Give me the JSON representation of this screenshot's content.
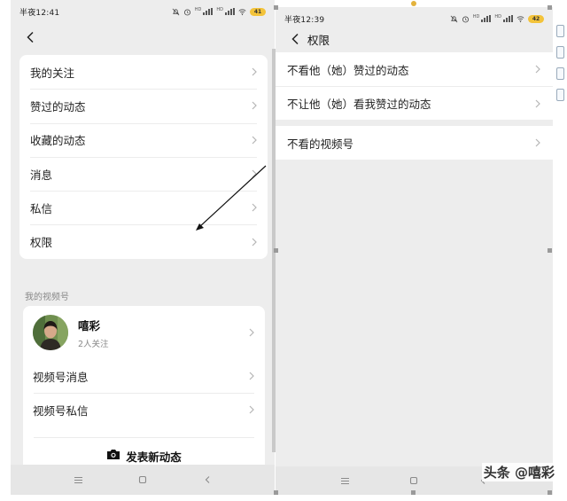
{
  "left": {
    "status": {
      "time": "半夜12:41",
      "battery": "41"
    },
    "menu": [
      {
        "label": "我的关注"
      },
      {
        "label": "赞过的动态"
      },
      {
        "label": "收藏的动态"
      },
      {
        "label": "消息"
      },
      {
        "label": "私信"
      },
      {
        "label": "权限"
      }
    ],
    "section_label": "我的视频号",
    "profile": {
      "name": "嘻彩",
      "followers": "2人关注"
    },
    "channel_menu": [
      {
        "label": "视频号消息"
      },
      {
        "label": "视频号私信"
      }
    ],
    "post_button": "发表新动态"
  },
  "right": {
    "status": {
      "time": "半夜12:39",
      "battery": "42"
    },
    "title": "权限",
    "group1": [
      {
        "label": "不看他（她）赞过的动态"
      },
      {
        "label": "不让他（她）看我赞过的动态"
      }
    ],
    "group2": [
      {
        "label": "不看的视频号"
      }
    ]
  },
  "watermark": "头条 @嘻彩",
  "colors": {
    "page_bg": "#ededed",
    "card_bg": "#ffffff",
    "battery": "#f3c33a",
    "text": "#222222",
    "muted": "#888888"
  },
  "icons": [
    "back-arrow-icon",
    "chevron-right-icon",
    "camera-icon",
    "menu-nav-icon",
    "home-nav-icon",
    "back-nav-icon",
    "wifi-icon",
    "alarm-icon",
    "mute-icon"
  ]
}
